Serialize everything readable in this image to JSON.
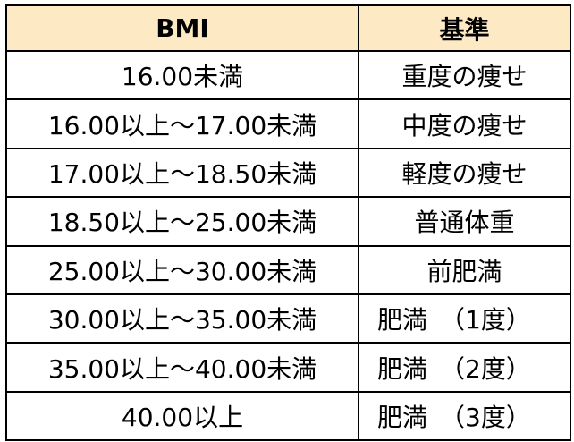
{
  "table": {
    "headers": [
      "BMI",
      "基準"
    ],
    "header_bg": "#fde9c3",
    "rows": [
      {
        "range": "16.00未満",
        "category": "重度の痩せ"
      },
      {
        "range": "16.00以上～17.00未満",
        "category": "中度の痩せ"
      },
      {
        "range": "17.00以上～18.50未満",
        "category": "軽度の痩せ"
      },
      {
        "range": "18.50以上～25.00未満",
        "category": "普通体重"
      },
      {
        "range": "25.00以上～30.00未満",
        "category": "前肥満"
      },
      {
        "range": "30.00以上～35.00未満",
        "category": "肥満　（1度）"
      },
      {
        "range": "35.00以上～40.00未満",
        "category": "肥満　（2度）"
      },
      {
        "range": "40.00以上",
        "category": "肥満　（3度）"
      }
    ]
  }
}
